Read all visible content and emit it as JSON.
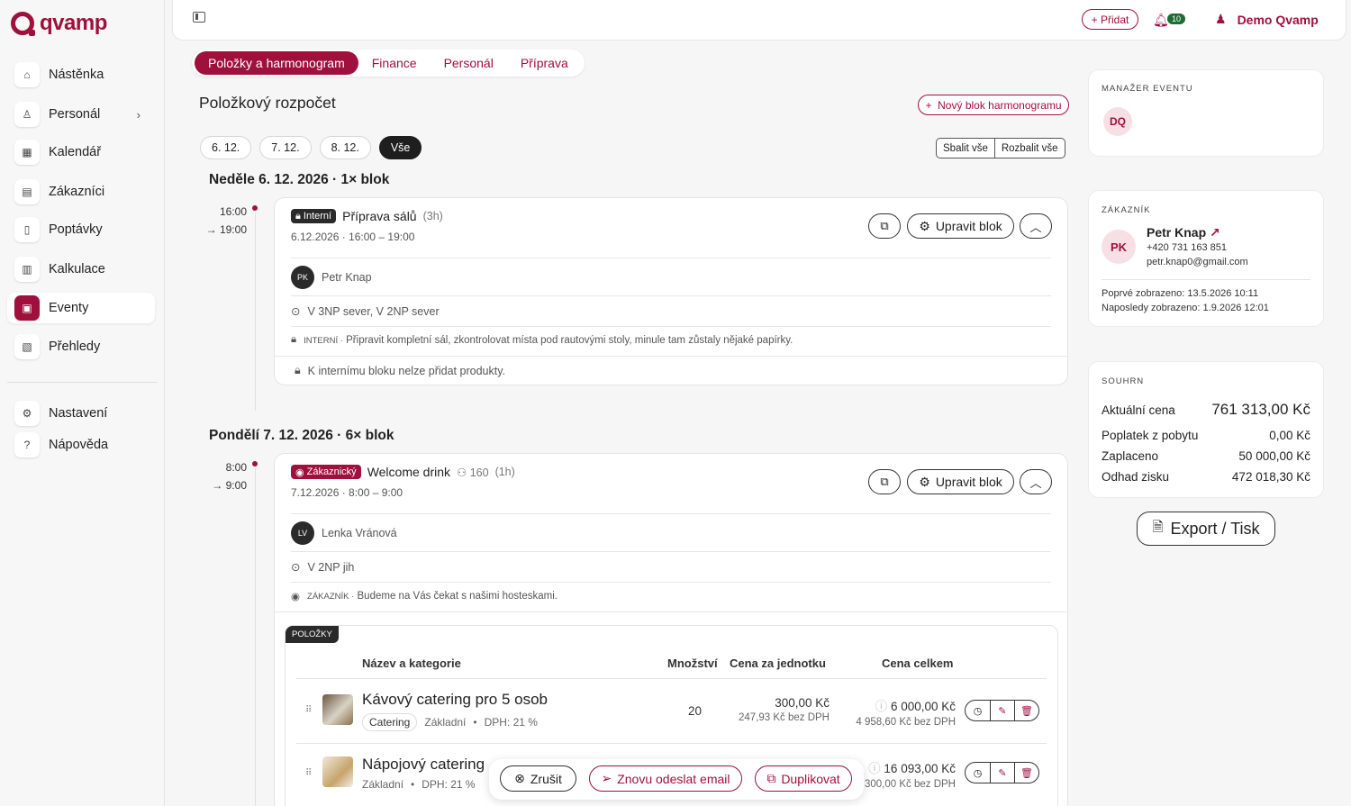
{
  "app": {
    "brand": "qvamp",
    "brand_color": "#a0103d"
  },
  "sidebar": {
    "items": [
      {
        "label": "Nástěnka",
        "icon": "home-icon"
      },
      {
        "label": "Personál",
        "icon": "person-icon"
      },
      {
        "label": "Kalendář",
        "icon": "calendar-icon"
      },
      {
        "label": "Zákazníci",
        "icon": "contact-card-icon"
      },
      {
        "label": "Poptávky",
        "icon": "document-icon"
      },
      {
        "label": "Kalkulace",
        "icon": "calculator-icon"
      },
      {
        "label": "Eventy",
        "icon": "event-icon"
      },
      {
        "label": "Přehledy",
        "icon": "report-icon"
      },
      {
        "label": "Nastavení",
        "icon": "gear-icon"
      },
      {
        "label": "Nápověda",
        "icon": "help-icon"
      }
    ]
  },
  "topbar": {
    "add_label": "Přidat",
    "notifications": "10",
    "user_name": "Demo Qvamp"
  },
  "tabs": [
    "Položky a harmonogram",
    "Finance",
    "Personál",
    "Příprava"
  ],
  "main": {
    "section_title": "Položkový rozpočet",
    "new_block_label": "Nový blok harmonogramu",
    "date_chips": [
      "6. 12.",
      "7. 12.",
      "8. 12.",
      "Vše"
    ],
    "collapse_all": "Sbalit vše",
    "expand_all": "Rozbalit vše",
    "edit_block_label": "Upravit blok",
    "days": [
      {
        "title": "Neděle 6. 12. 2026 · 1× blok",
        "block": {
          "time_start": "16:00",
          "time_end": "→ 19:00",
          "tag": "Interní",
          "name": "Příprava sálů",
          "duration": "(3h)",
          "date_range": "6.12.2026 · 16:00 – 19:00",
          "person_initials": "PK",
          "person": "Petr Knap",
          "location": "V 3NP sever, V 2NP sever",
          "note_label": "INTERNÍ ·",
          "note": "Připravit kompletní sál, zkontrolovat místa pod rautovými stoly, minule tam zůstaly nějaké papírky.",
          "no_products": "K internímu bloku nelze přidat produkty."
        }
      },
      {
        "title": "Pondělí 7. 12. 2026 · 6× blok",
        "block": {
          "time_start": "8:00",
          "time_end": "→ 9:00",
          "tag": "Zákaznický",
          "name": "Welcome drink",
          "guests": "160",
          "duration": "(1h)",
          "date_range": "7.12.2026 · 8:00 – 9:00",
          "person_initials": "LV",
          "person": "Lenka Vránová",
          "location": "V 2NP jih",
          "note_label": "ZÁKAZNÍK ·",
          "note": "Budeme na Vás čekat s našimi hosteskami."
        }
      }
    ],
    "items_table": {
      "tag": "POLOŽKY",
      "headers": [
        "Název a kategorie",
        "Množství",
        "Cena za jednotku",
        "Cena celkem"
      ],
      "rows": [
        {
          "name": "Kávový catering pro 5 osob",
          "category": "Catering",
          "type": "Základní",
          "vat": "DPH: 21 %",
          "qty": "20",
          "unit_price": "300,00 Kč",
          "unit_price_net": "247,93 Kč bez DPH",
          "total": "6 000,00 Kč",
          "total_net": "4 958,60 Kč bez DPH"
        },
        {
          "name": "Nápojový catering",
          "type": "Základní",
          "vat": "DPH: 21 %",
          "total": "16 093,00 Kč",
          "total_net": "300,00 Kč bez DPH"
        }
      ]
    }
  },
  "floatbar": {
    "cancel": "Zrušit",
    "resend": "Znovu odeslat email",
    "duplicate": "Duplikovat"
  },
  "right": {
    "manager": {
      "label": "MANAŽER EVENTU",
      "initials": "DQ"
    },
    "customer": {
      "label": "ZÁKAZNÍK",
      "initials": "PK",
      "name": "Petr Knap",
      "phone": "+420 731 163 851",
      "email": "petr.knap0@gmail.com",
      "first_seen": "Poprvé zobrazeno: 13.5.2026 10:11",
      "last_seen": "Naposledy zobrazeno: 1.9.2026 12:01"
    },
    "summary": {
      "label": "SOUHRN",
      "rows": [
        {
          "label": "Aktuální cena",
          "value": "761 313,00 Kč"
        },
        {
          "label": "Poplatek z pobytu",
          "value": "0,00 Kč"
        },
        {
          "label": "Zaplaceno",
          "value": "50 000,00 Kč"
        },
        {
          "label": "Odhad zisku",
          "value": "472 018,30 Kč"
        }
      ]
    },
    "export_label": "Export / Tisk"
  }
}
